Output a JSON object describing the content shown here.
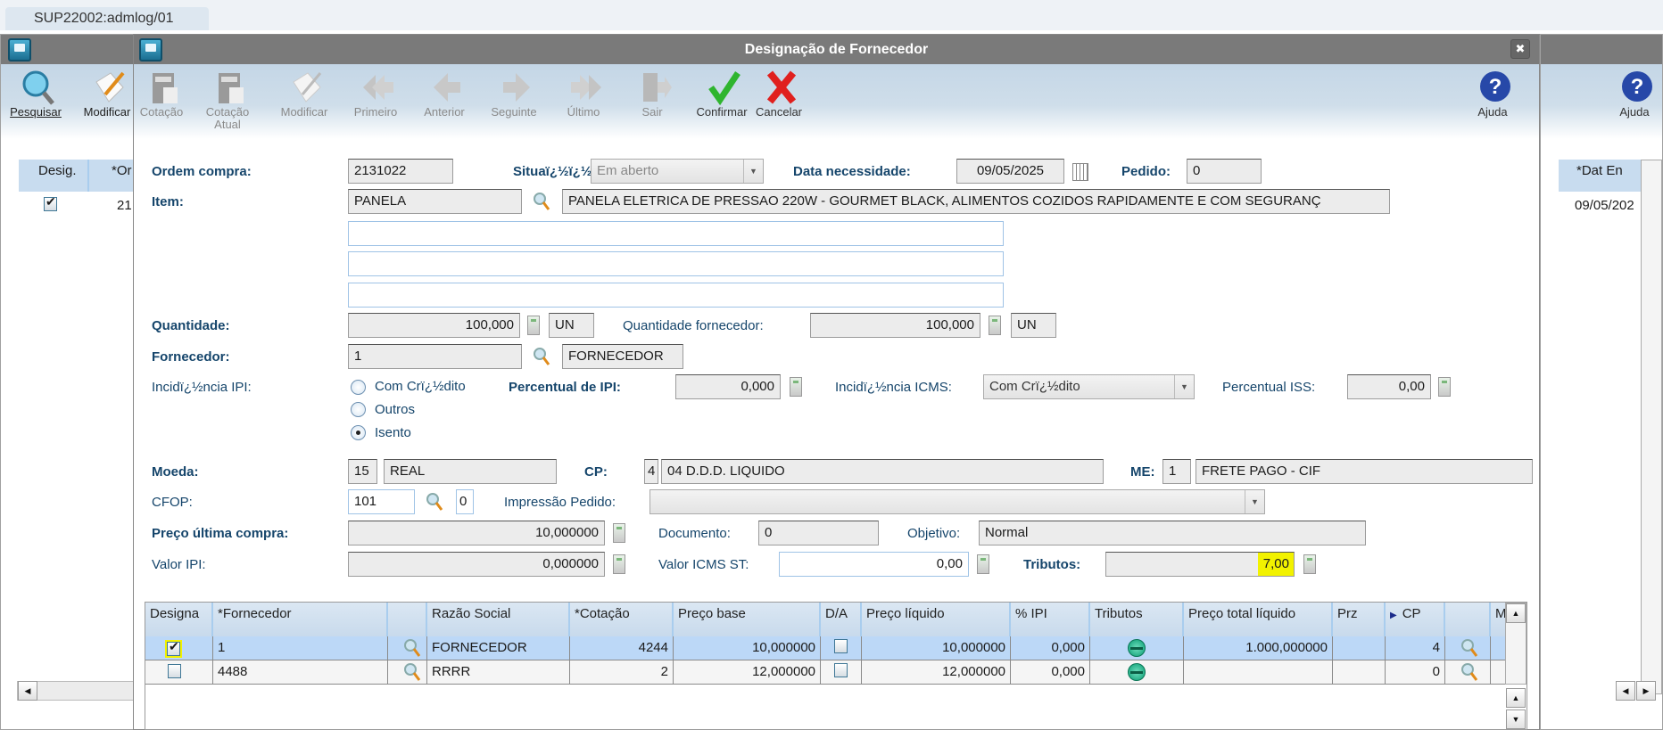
{
  "tab": {
    "label": "SUP22002:admlog/01"
  },
  "background_window": {
    "toolbar": [
      {
        "label": "Pesquisar",
        "icon": "search-icon"
      },
      {
        "label": "Modificar",
        "icon": "edit-icon"
      }
    ],
    "right_toolbar": {
      "label": "Ajuda",
      "icon": "help-icon"
    },
    "grid_left": {
      "headers": [
        "Desig.",
        "*Or"
      ],
      "row": {
        "checked": true,
        "value": "21"
      }
    },
    "grid_right": {
      "headers": [
        "*Dat En"
      ],
      "row": [
        "09/05/202"
      ]
    }
  },
  "dialog": {
    "title": "Designação de Fornecedor",
    "toolbar": [
      {
        "label": "Cotação",
        "enabled": false
      },
      {
        "label": "Cotação Atual",
        "enabled": false
      },
      {
        "label": "Modificar",
        "enabled": false
      },
      {
        "label": "Primeiro",
        "enabled": false
      },
      {
        "label": "Anterior",
        "enabled": false
      },
      {
        "label": "Seguinte",
        "enabled": false
      },
      {
        "label": "Último",
        "enabled": false
      },
      {
        "label": "Sair",
        "enabled": false
      },
      {
        "label": "Confirmar",
        "enabled": true
      },
      {
        "label": "Cancelar",
        "enabled": true
      }
    ],
    "help_label": "Ajuda",
    "form": {
      "ordem_compra": {
        "label": "Ordem compra:",
        "value": "2131022"
      },
      "situacao": {
        "label": "Situaï¿½ï¿½o:",
        "value": "Em aberto"
      },
      "data_necessidade": {
        "label": "Data necessidade:",
        "value": "09/05/2025"
      },
      "pedido": {
        "label": "Pedido:",
        "value": "0"
      },
      "item": {
        "label": "Item:",
        "code": "PANELA",
        "description": "PANELA ELETRICA DE PRESSAO 220W - GOURMET BLACK, ALIMENTOS COZIDOS RAPIDAMENTE E COM SEGURANÇ"
      },
      "extra_lines": [
        "",
        "",
        ""
      ],
      "quantidade": {
        "label": "Quantidade:",
        "value": "100,000",
        "unit": "UN"
      },
      "quantidade_fornecedor": {
        "label": "Quantidade fornecedor:",
        "value": "100,000",
        "unit": "UN"
      },
      "fornecedor": {
        "label": "Fornecedor:",
        "code": "1",
        "name": "FORNECEDOR"
      },
      "incidencia_ipi": {
        "label": "Incidï¿½ncia IPI:",
        "options": [
          "Com Crï¿½dito",
          "Outros",
          "Isento"
        ],
        "selected": "Isento"
      },
      "percentual_ipi": {
        "label": "Percentual de IPI:",
        "value": "0,000"
      },
      "incidencia_icms": {
        "label": "Incidï¿½ncia ICMS:",
        "value": "Com Crï¿½dito"
      },
      "percentual_iss": {
        "label": "Percentual ISS:",
        "value": "0,00"
      },
      "moeda": {
        "label": "Moeda:",
        "code": "15",
        "name": "REAL"
      },
      "cp": {
        "label": "CP:",
        "code": "4",
        "name": "04 D.D.D. LIQUIDO"
      },
      "me": {
        "label": "ME:",
        "code": "1",
        "name": "FRETE PAGO - CIF"
      },
      "cfop": {
        "label": "CFOP:",
        "value": "101",
        "sub": "0"
      },
      "impressao_pedido": {
        "label": "Impressão Pedido:",
        "value": ""
      },
      "preco_ultima_compra": {
        "label": "Preço  última compra:",
        "value": "10,000000"
      },
      "documento": {
        "label": "Documento:",
        "value": "0"
      },
      "objetivo": {
        "label": "Objetivo:",
        "value": "Normal"
      },
      "valor_ipi": {
        "label": "Valor IPI:",
        "value": "0,000000"
      },
      "valor_icms_st": {
        "label": "Valor ICMS ST:",
        "value": "0,00"
      },
      "tributos": {
        "label": "Tributos:",
        "value": "7,00"
      }
    },
    "grid": {
      "headers": [
        "Designa",
        "*Fornecedor",
        "",
        "Razão Social",
        "*Cotação",
        "Preço base",
        "D/A",
        "Preço líquido",
        "% IPI",
        "Tributos",
        "Preço total líquido",
        "Prz",
        "CP",
        "",
        "M"
      ],
      "rows": [
        {
          "designa": true,
          "fornecedor": "1",
          "razao": "FORNECEDOR",
          "cotacao": "4244",
          "preco_base": "10,000000",
          "da": false,
          "preco_liquido": "10,000000",
          "ipi": "0,000",
          "preco_total": "1.000,000000",
          "prz": "",
          "cp": "4",
          "selected": true
        },
        {
          "designa": false,
          "fornecedor": "4488",
          "razao": "RRRR",
          "cotacao": "2",
          "preco_base": "12,000000",
          "da": false,
          "preco_liquido": "12,000000",
          "ipi": "0,000",
          "preco_total": "",
          "prz": "",
          "cp": "0",
          "selected": false
        }
      ]
    },
    "colors": {
      "highlight": "#f2f200",
      "selected_row": "#bcd8f7",
      "label": "#15456b"
    }
  }
}
